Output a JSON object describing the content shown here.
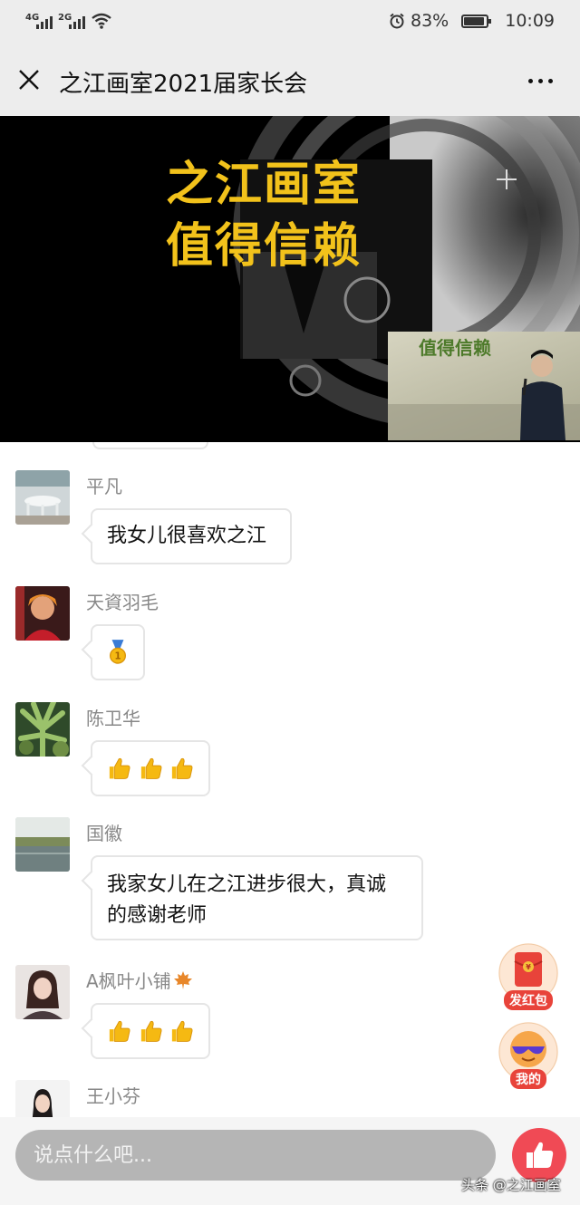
{
  "status_bar": {
    "signal_1": "4G",
    "signal_2": "2G",
    "battery": "83%",
    "battery_level": 0.83,
    "time": "10:09"
  },
  "header": {
    "title": "之江画室2021届家长会",
    "close_icon": "close-icon",
    "more_icon": "more-icon"
  },
  "video": {
    "slide_line1": "之江画室",
    "slide_line2": "值得信赖",
    "pip_text": "值得信赖",
    "accent_color": "#f2c21b"
  },
  "chat": {
    "messages": [
      {
        "sender": "平凡",
        "text": "我女儿很喜欢之江"
      },
      {
        "sender": "天資羽毛",
        "emoji": [
          "medal-icon"
        ]
      },
      {
        "sender": "陈卫华",
        "emoji": [
          "thumbs-up-icon",
          "thumbs-up-icon",
          "thumbs-up-icon"
        ]
      },
      {
        "sender": "国徽",
        "text_line1": "我家女儿在之江进步很大，真诚",
        "text_line2": "的感谢老师"
      },
      {
        "sender": "A枫叶小铺",
        "sender_icon": "maple-leaf-icon",
        "emoji": [
          "thumbs-up-icon",
          "thumbs-up-icon",
          "thumbs-up-icon"
        ]
      },
      {
        "sender": "王小芬"
      }
    ]
  },
  "floating": {
    "red_packet_label": "发红包",
    "mine_label": "我的"
  },
  "input": {
    "placeholder": "说点什么吧..."
  },
  "watermark": "头条 @之江画室",
  "colors": {
    "like_button": "#f04a55",
    "red_packet": "#e8433a"
  }
}
